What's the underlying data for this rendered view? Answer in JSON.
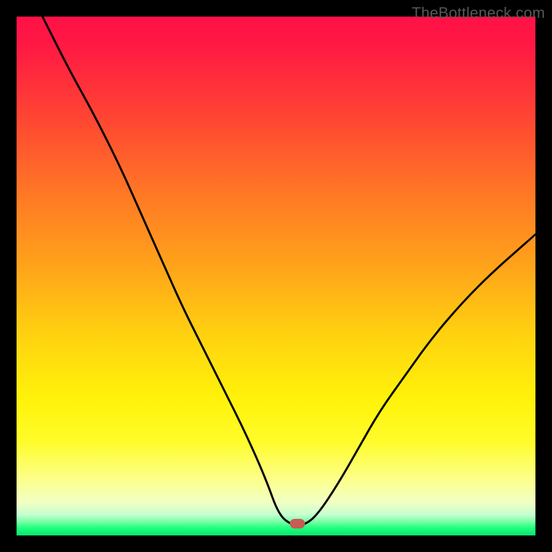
{
  "watermark": "TheBottleneck.com",
  "plot": {
    "inner_w": 752,
    "inner_h": 752
  },
  "marker": {
    "x_frac": 0.541,
    "y_frac": 0.977
  },
  "chart_data": {
    "type": "line",
    "title": "",
    "xlabel": "",
    "ylabel": "",
    "xlim": [
      0,
      100
    ],
    "ylim": [
      0,
      100
    ],
    "series": [
      {
        "name": "bottleneck-curve",
        "x": [
          5,
          10,
          15,
          20,
          24,
          28,
          32,
          36,
          40,
          44,
          48,
          50.5,
          53,
          55.5,
          58,
          62,
          66,
          70,
          75,
          80,
          86,
          92,
          100
        ],
        "y": [
          100,
          90,
          81,
          71,
          62,
          53,
          44,
          36,
          28,
          20,
          11,
          4,
          2,
          2,
          4,
          10,
          17,
          24,
          31,
          38,
          45,
          51,
          58
        ]
      }
    ],
    "annotations": [
      {
        "type": "marker",
        "x": 54.1,
        "y": 2.3,
        "label": "optimal-point"
      }
    ],
    "background_gradient": {
      "orientation": "vertical",
      "stops": [
        {
          "pos": 0.0,
          "color": "#ff1146"
        },
        {
          "pos": 0.5,
          "color": "#ffb316"
        },
        {
          "pos": 0.8,
          "color": "#fffc2b"
        },
        {
          "pos": 0.985,
          "color": "#1eff7c"
        },
        {
          "pos": 1.0,
          "color": "#06e76f"
        }
      ]
    }
  }
}
